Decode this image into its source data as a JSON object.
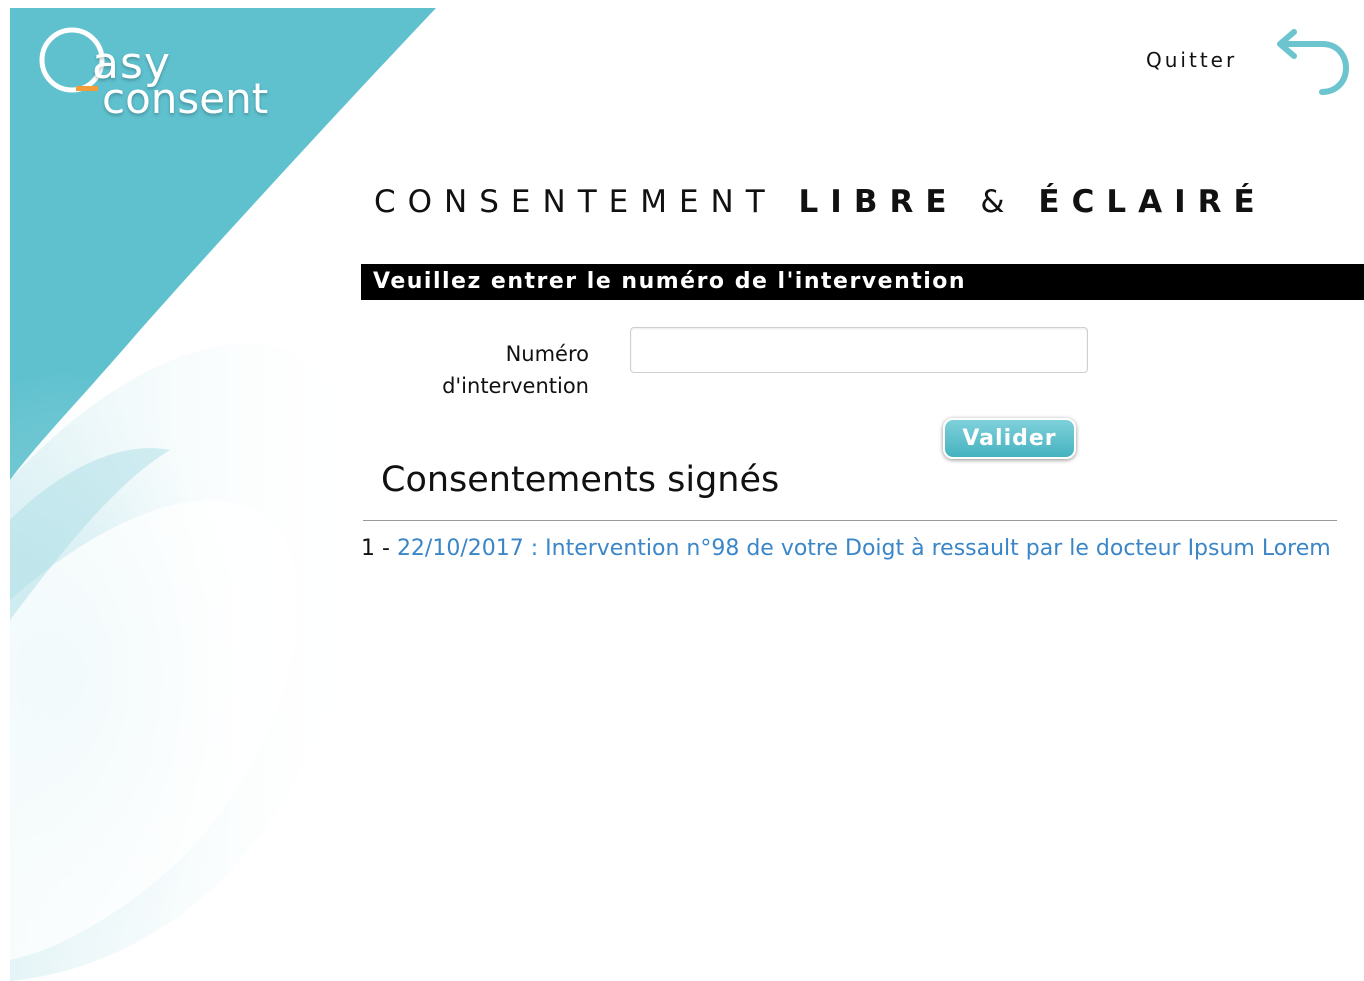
{
  "brand": {
    "logo_word1": "asy",
    "logo_word2": "consent",
    "logo_initial": "e",
    "accent": "#5fc1ce"
  },
  "header": {
    "quit_label": "Quitter",
    "quit_icon": "undo-arrow-icon"
  },
  "title": {
    "light": "CONSENTEMENT",
    "bold1": "LIBRE",
    "amp": "&",
    "bold2": "ÉCLAIRÉ"
  },
  "banner": {
    "text": "Veuillez entrer le numéro de l'intervention"
  },
  "form": {
    "label_line1": "Numéro",
    "label_line2": "d'intervention",
    "input_value": "",
    "input_placeholder": "",
    "submit_label": "Valider"
  },
  "signed": {
    "title": "Consentements signés",
    "items": [
      {
        "index": "1 -",
        "text": "22/10/2017 : Intervention n°98 de votre Doigt à ressault par le docteur Ipsum Lorem"
      }
    ]
  }
}
